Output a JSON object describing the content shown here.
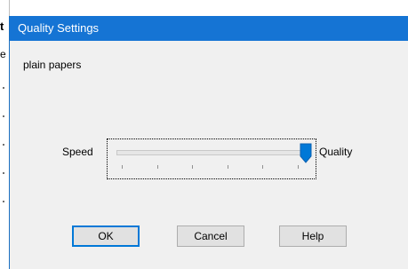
{
  "background_window": {
    "fragment_top": "t",
    "fragment_second": "e"
  },
  "dialog": {
    "title": "Quality Settings",
    "paper_type": "plain papers",
    "slider": {
      "min_label": "Speed",
      "max_label": "Quality",
      "value_fraction": 1.0,
      "tick_count": 6
    },
    "buttons": {
      "ok": "OK",
      "cancel": "Cancel",
      "help": "Help"
    }
  },
  "colors": {
    "titlebar": "#1574d4",
    "title_text": "#ffffff",
    "dialog_bg": "#f0f0f0",
    "slider_thumb": "#0078d7",
    "default_button_border": "#0078d7"
  }
}
